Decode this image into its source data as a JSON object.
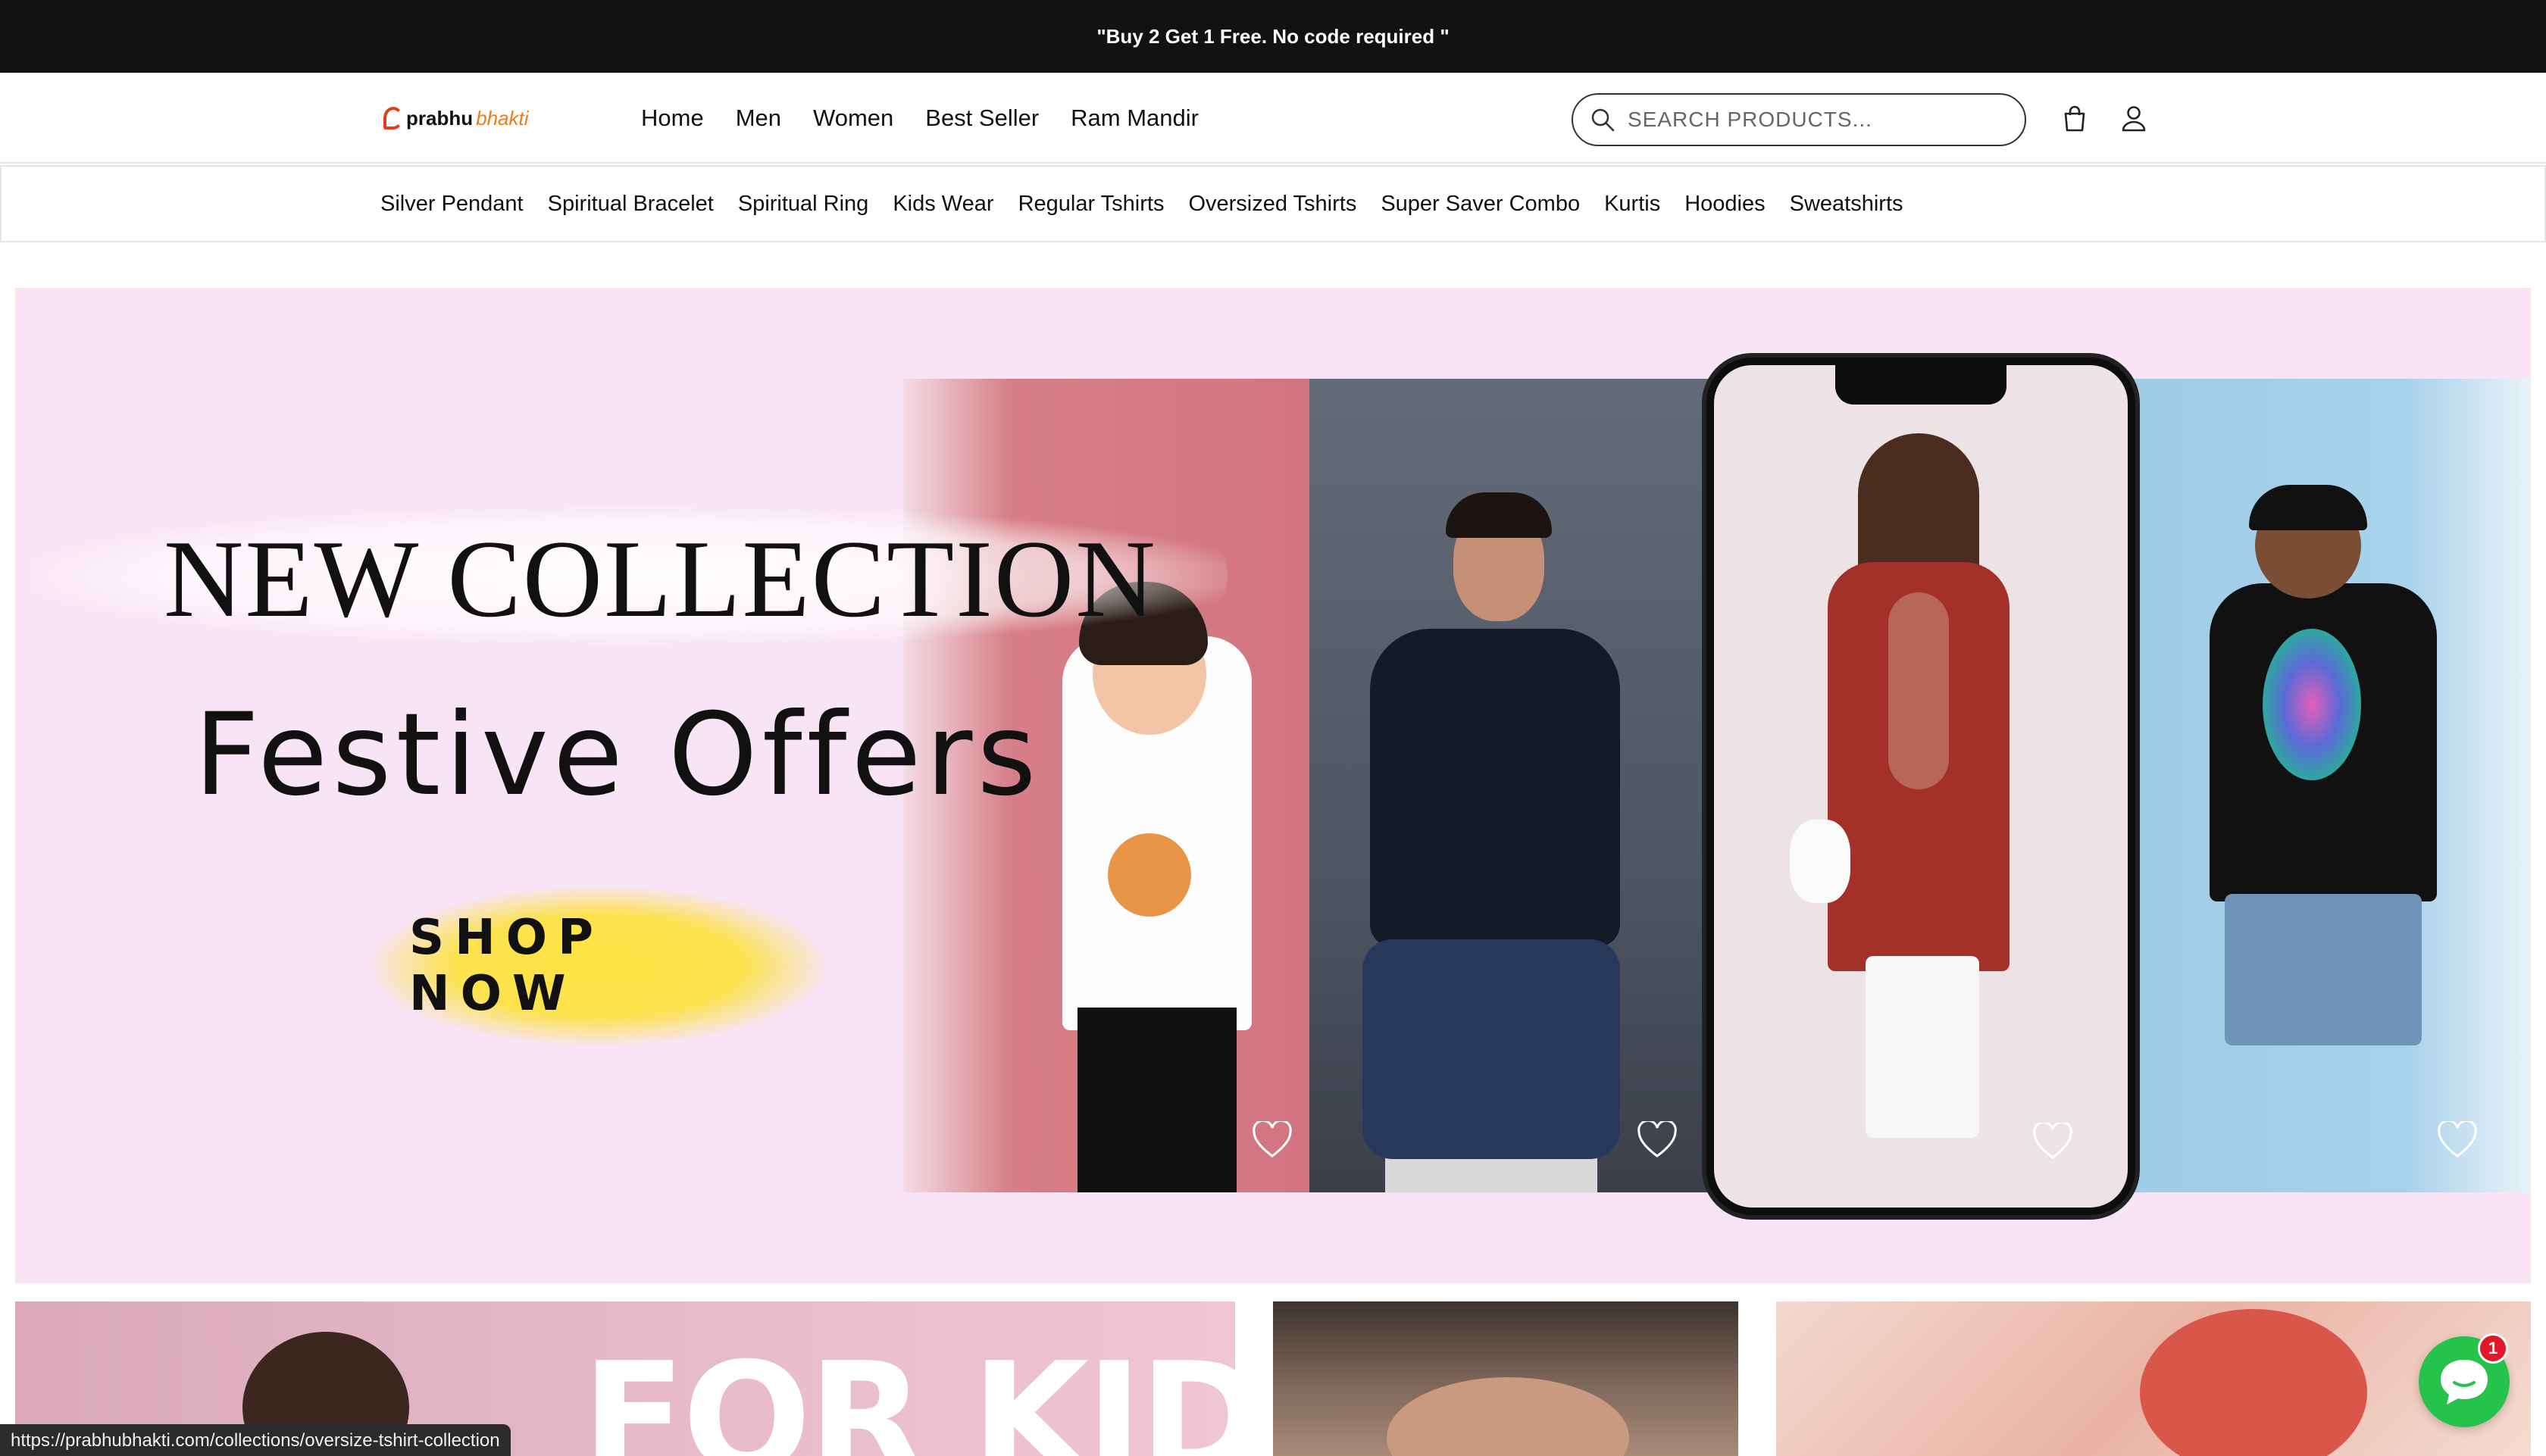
{
  "announcement": "\"Buy 2 Get 1 Free. No code required \"",
  "header": {
    "logo_text_1": "prabhu",
    "logo_text_2": "bhakti",
    "nav": [
      "Home",
      "Men",
      "Women",
      "Best Seller",
      "Ram Mandir"
    ],
    "search_placeholder": "SEARCH PRODUCTS...",
    "icons": [
      "search-icon",
      "cart-icon",
      "account-icon"
    ]
  },
  "categories": [
    "Silver Pendant",
    "Spiritual Bracelet",
    "Spiritual Ring",
    "Kids Wear",
    "Regular Tshirts",
    "Oversized Tshirts",
    "Super Saver Combo",
    "Kurtis",
    "Hoodies",
    "Sweatshirts"
  ],
  "hero": {
    "title": "NEW COLLECTION",
    "subtitle": "Festive Offers",
    "cta": "SHOP NOW",
    "colors": {
      "background": "#f8e4f4",
      "cta_glow": "#ffe342"
    }
  },
  "tiles": {
    "kids_text": "FOR KIDS"
  },
  "status_url": "https://prabhubhakti.com/collections/oversize-tshirt-collection",
  "chat": {
    "badge_count": "1",
    "icon": "chat-icon"
  },
  "colors": {
    "accent": "#25c24c",
    "badge": "#e0192a",
    "logo_red": "#e63a1c",
    "logo_orange": "#f07a14"
  }
}
